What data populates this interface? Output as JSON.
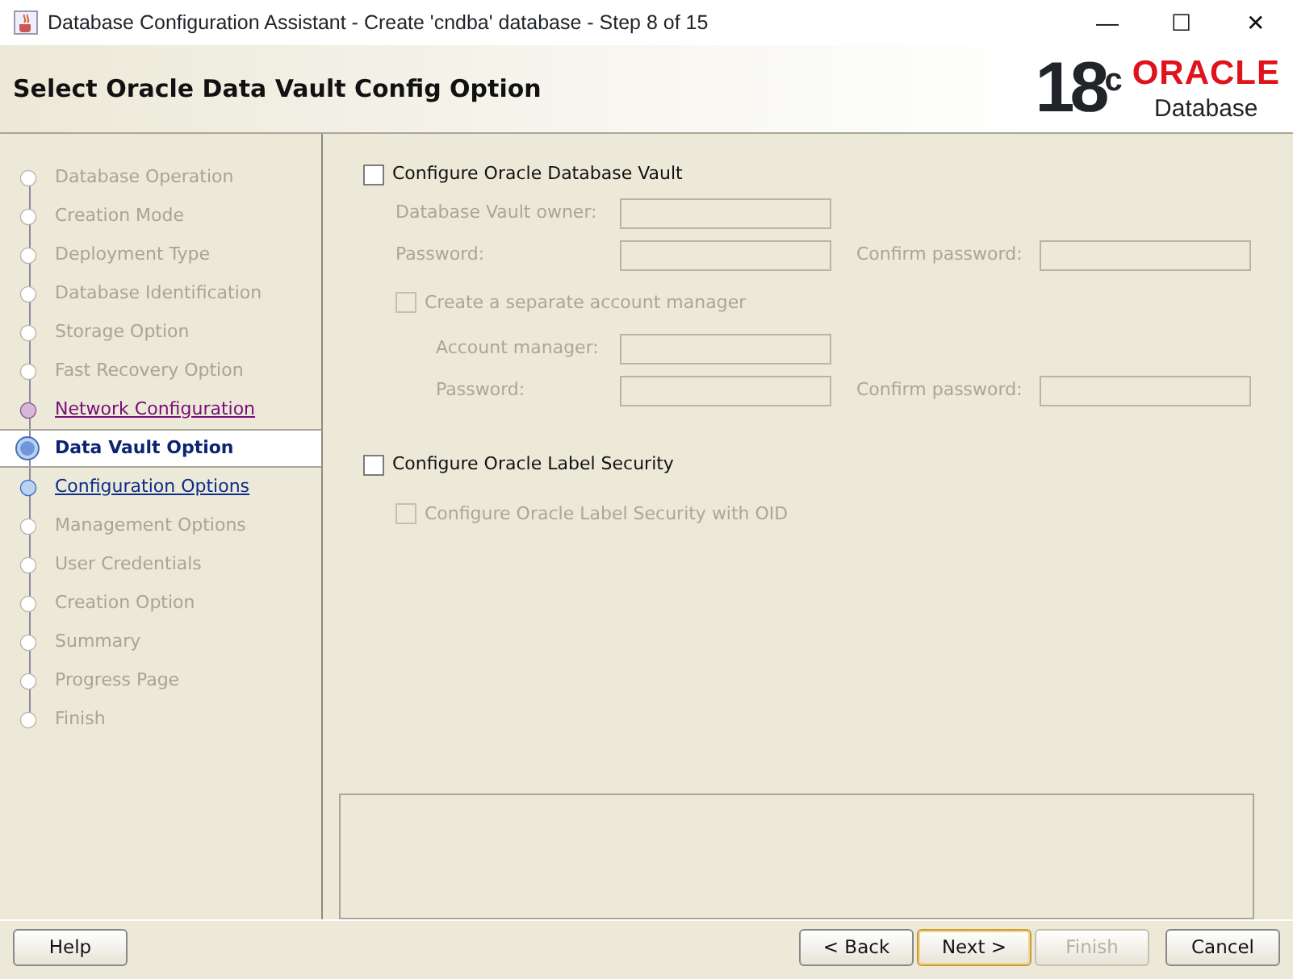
{
  "window": {
    "title": "Database Configuration Assistant - Create 'cndba' database - Step 8 of 15",
    "controls": [
      "—",
      "☐",
      "✕"
    ]
  },
  "header": {
    "title": "Select Oracle Data Vault Config Option",
    "logo_version": "18",
    "logo_sup": "c",
    "logo_brand": "ORACLE",
    "logo_product": "Database"
  },
  "steps": [
    {
      "label": "Database Operation",
      "kind": "disabled",
      "selected": false
    },
    {
      "label": "Creation Mode",
      "kind": "disabled",
      "selected": false
    },
    {
      "label": "Deployment Type",
      "kind": "disabled",
      "selected": false
    },
    {
      "label": "Database Identification",
      "kind": "disabled",
      "selected": false
    },
    {
      "label": "Storage Option",
      "kind": "disabled",
      "selected": false
    },
    {
      "label": "Fast Recovery Option",
      "kind": "disabled",
      "selected": false
    },
    {
      "label": "Network Configuration",
      "kind": "visited",
      "selected": false
    },
    {
      "label": "Data Vault Option",
      "kind": "current",
      "selected": true
    },
    {
      "label": "Configuration Options",
      "kind": "link",
      "selected": false
    },
    {
      "label": "Management Options",
      "kind": "disabled",
      "selected": false
    },
    {
      "label": "User Credentials",
      "kind": "disabled",
      "selected": false
    },
    {
      "label": "Creation Option",
      "kind": "disabled",
      "selected": false
    },
    {
      "label": "Summary",
      "kind": "disabled",
      "selected": false
    },
    {
      "label": "Progress Page",
      "kind": "disabled",
      "selected": false
    },
    {
      "label": "Finish",
      "kind": "disabled",
      "selected": false
    }
  ],
  "vault": {
    "label": "Configure Oracle Database Vault",
    "checked": false,
    "disabled": false,
    "owner_label": "Database Vault owner:",
    "password_label": "Password:",
    "confirm_label": "Confirm password:",
    "manager_check": {
      "label": "Create a separate account manager",
      "checked": false,
      "disabled": true
    },
    "manager_label": "Account manager:",
    "manager_password_label": "Password:",
    "manager_confirm_label": "Confirm password:"
  },
  "label_security": {
    "label": "Configure Oracle Label Security",
    "checked": false,
    "disabled": false,
    "oid_check": {
      "label": "Configure Oracle Label Security with OID",
      "checked": false,
      "disabled": true
    }
  },
  "buttons": [
    {
      "label": "Help",
      "kind": "left",
      "disabled": false,
      "default": false
    },
    {
      "label": "< Back",
      "kind": "right",
      "disabled": false,
      "default": false
    },
    {
      "label": "Next >",
      "kind": "right",
      "disabled": false,
      "default": true
    },
    {
      "label": "Finish",
      "kind": "right",
      "disabled": true,
      "default": false
    },
    {
      "label": "Cancel",
      "kind": "right",
      "disabled": false,
      "default": false
    }
  ]
}
